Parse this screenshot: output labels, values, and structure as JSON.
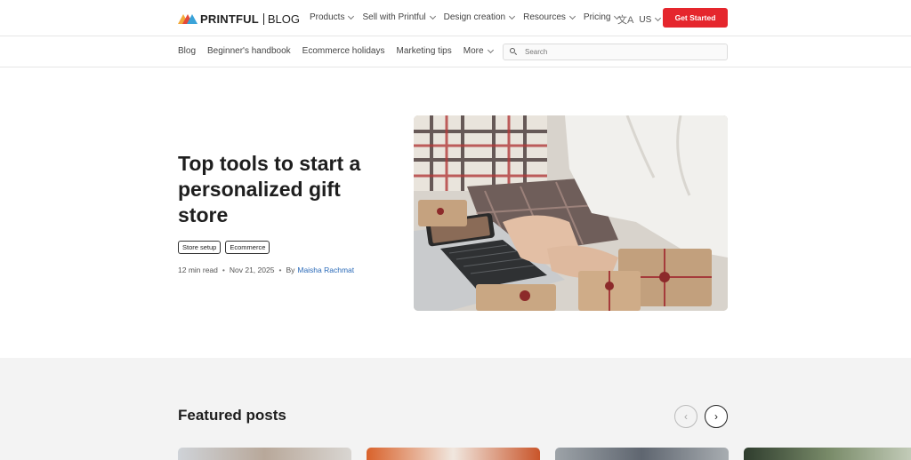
{
  "header": {
    "logo_text": "PRINTFUL",
    "logo_sub": "BLOG",
    "menu": [
      {
        "label": "Products"
      },
      {
        "label": "Sell with Printful"
      },
      {
        "label": "Design creation"
      },
      {
        "label": "Resources"
      },
      {
        "label": "Pricing"
      }
    ],
    "language_icon": "translate-icon",
    "language": "US",
    "cta_label": "Get Started"
  },
  "subnav": {
    "items": [
      {
        "label": "Blog"
      },
      {
        "label": "Beginner's handbook"
      },
      {
        "label": "Ecommerce holidays"
      },
      {
        "label": "Marketing tips"
      },
      {
        "label": "More"
      }
    ],
    "search_placeholder": "Search"
  },
  "hero": {
    "title": "Top tools to start a personalized gift store",
    "tags": [
      "Store setup",
      "Ecommerce"
    ],
    "read_time": "12 min read",
    "date": "Nov 21, 2025",
    "by": "By",
    "author": "Maisha Rachmat"
  },
  "featured": {
    "title": "Featured posts",
    "prev_icon": "chevron-left-icon",
    "next_icon": "chevron-right-icon"
  },
  "colors": {
    "accent": "#e5262d",
    "link": "#2a6ab8",
    "featured_bg": "#f3f3f3"
  }
}
